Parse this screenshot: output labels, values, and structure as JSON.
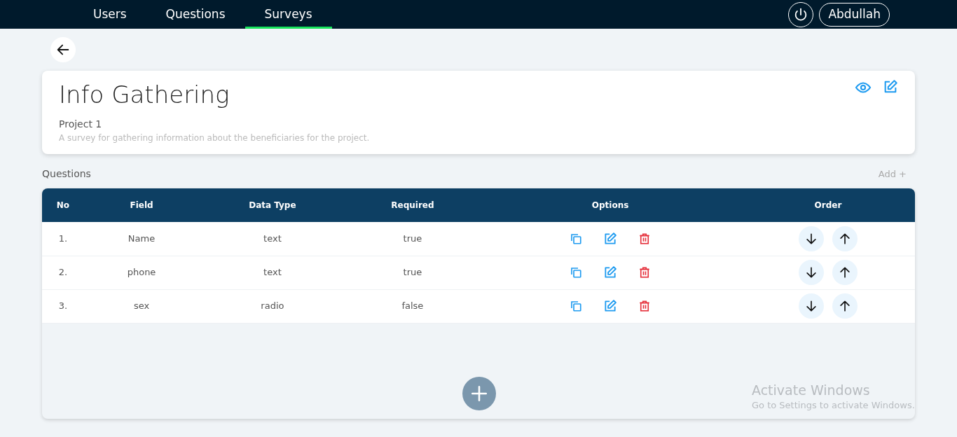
{
  "nav": {
    "tabs": [
      {
        "label": "Users",
        "selected": false
      },
      {
        "label": "Questions",
        "selected": false
      },
      {
        "label": "Surveys",
        "selected": true
      }
    ],
    "user": "Abdullah"
  },
  "survey": {
    "title": "Info Gathering",
    "project": "Project 1",
    "description": "A survey for gathering information about the beneficiaries for the project."
  },
  "questions": {
    "heading": "Questions",
    "add_link": "Add +",
    "columns": [
      "No",
      "Field",
      "Data Type",
      "Required",
      "Options",
      "Order"
    ],
    "rows": [
      {
        "no": "1.",
        "field": "Name",
        "data_type": "text",
        "required": "true"
      },
      {
        "no": "2.",
        "field": "phone",
        "data_type": "text",
        "required": "true"
      },
      {
        "no": "3.",
        "field": "sex",
        "data_type": "radio",
        "required": "false"
      }
    ]
  },
  "os_notice": {
    "title": "Activate Windows",
    "subtitle": "Go to Settings to activate Windows."
  }
}
